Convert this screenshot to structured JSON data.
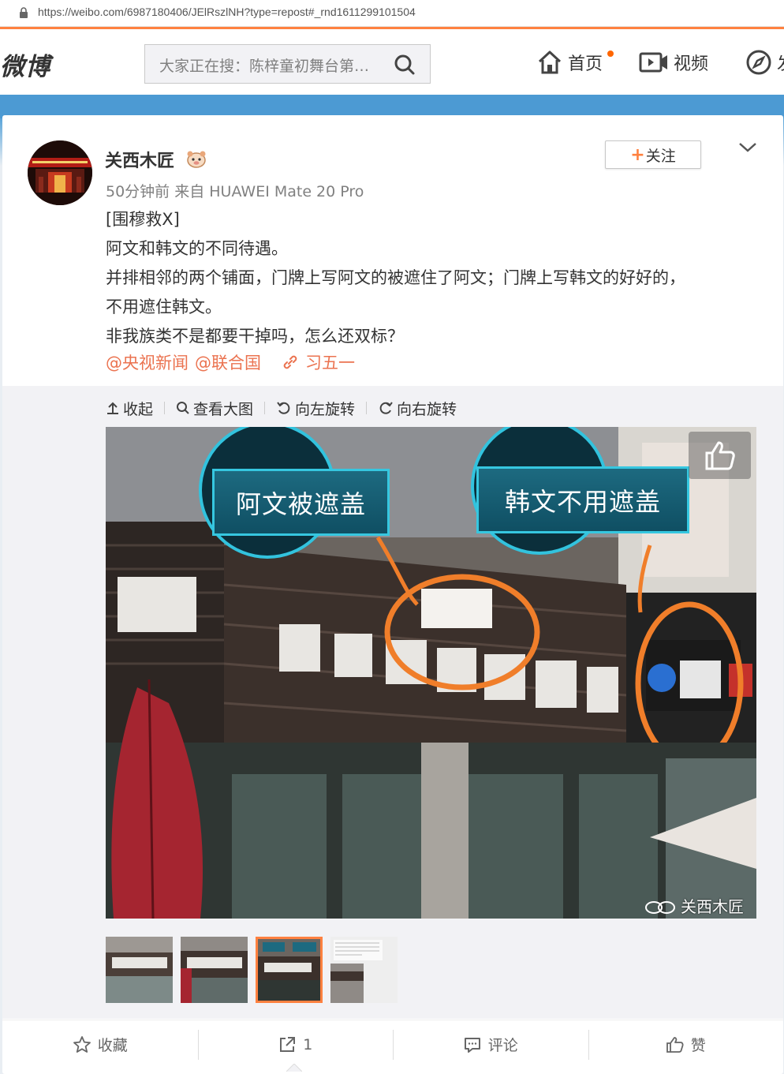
{
  "browser": {
    "url": "https://weibo.com/6987180406/JElRszlNH?type=repost#_rnd1611299101504"
  },
  "nav": {
    "logo": "微博",
    "search_placeholder": "大家正在搜：陈梓童初舞台第…",
    "items": [
      {
        "label": "首页",
        "icon": "home-icon"
      },
      {
        "label": "视频",
        "icon": "video-icon"
      },
      {
        "label": "发",
        "icon": "compass-icon"
      }
    ]
  },
  "post": {
    "author": "关西木匠",
    "meta": "50分钟前 来自 HUAWEI Mate 20 Pro",
    "follow_label": "关注",
    "lines": [
      "[围穆救X]",
      "阿文和韩文的不同待遇。",
      "并排相邻的两个铺面，门牌上写阿文的被遮住了阿文；门牌上写韩文的好好的，",
      "不用遮住韩文。",
      "非我族类不是都要干掉吗，怎么还双标？"
    ],
    "mentions": [
      "@央视新闻",
      "@联合国"
    ],
    "tag": "习五一"
  },
  "media": {
    "toolbar": [
      "收起",
      "查看大图",
      "向左旋转",
      "向右旋转"
    ],
    "photo": {
      "bubble_left": "阿文被遮盖",
      "bubble_right": "韩文不用遮盖",
      "watermark": "关西木匠"
    }
  },
  "actions": {
    "collect": "收藏",
    "repost_count": "1",
    "comment": "评论",
    "like": "赞"
  },
  "colors": {
    "accent": "#ff8140",
    "mention": "#eb7350",
    "band": "#4c9ad3"
  }
}
